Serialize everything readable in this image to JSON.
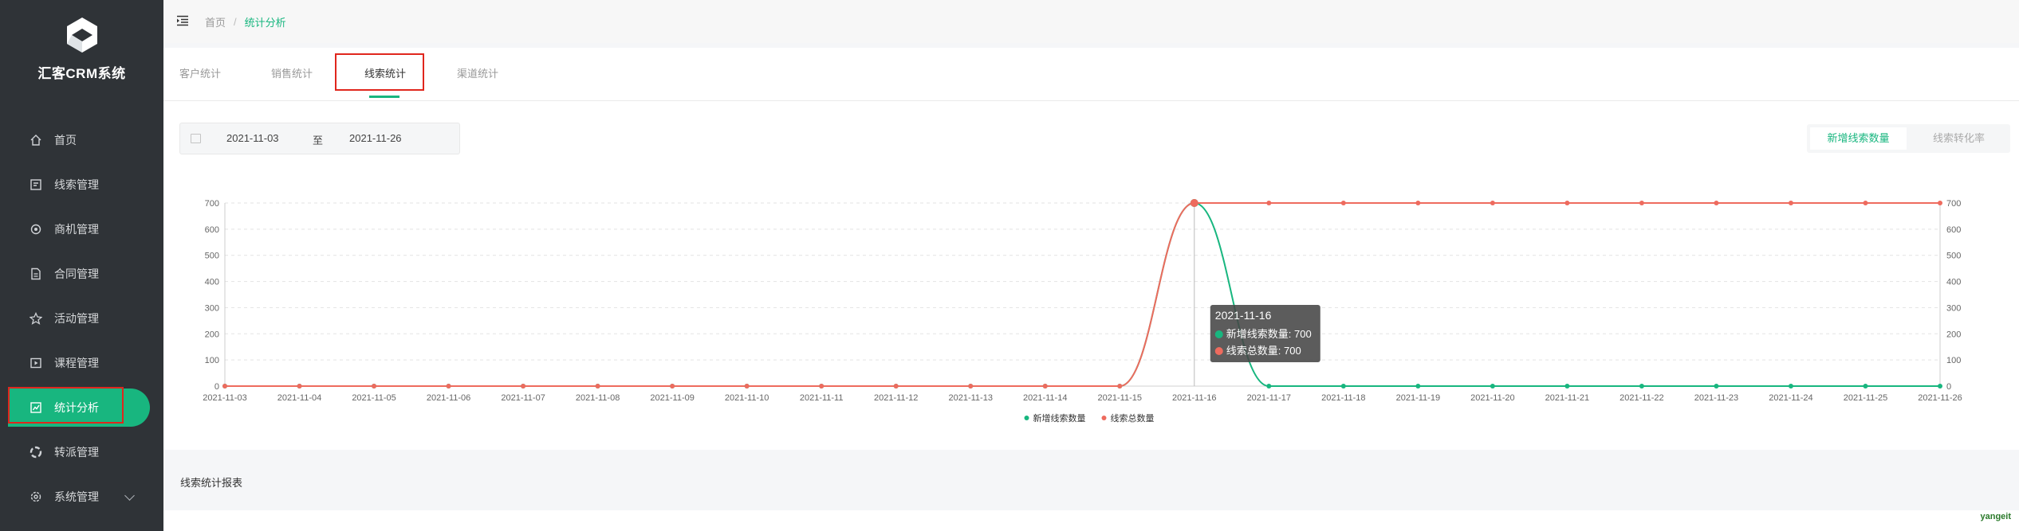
{
  "brand": {
    "name": "汇客CRM系统"
  },
  "sidebar": {
    "items": [
      {
        "label": "首页",
        "icon": "home-icon"
      },
      {
        "label": "线索管理",
        "icon": "clue-icon"
      },
      {
        "label": "商机管理",
        "icon": "opportunity-icon"
      },
      {
        "label": "合同管理",
        "icon": "contract-icon"
      },
      {
        "label": "活动管理",
        "icon": "activity-icon"
      },
      {
        "label": "课程管理",
        "icon": "course-icon"
      },
      {
        "label": "统计分析",
        "icon": "chart-icon",
        "active": true
      },
      {
        "label": "转派管理",
        "icon": "transfer-icon"
      },
      {
        "label": "系统管理",
        "icon": "settings-icon",
        "expandable": true
      }
    ]
  },
  "breadcrumb": {
    "home": "首页",
    "separator": "/",
    "current": "统计分析"
  },
  "tabs": [
    {
      "label": "客户统计"
    },
    {
      "label": "销售统计"
    },
    {
      "label": "线索统计",
      "active": true
    },
    {
      "label": "渠道统计"
    }
  ],
  "date_range": {
    "start": "2021-11-03",
    "separator": "至",
    "end": "2021-11-26"
  },
  "metric_toggle": {
    "selected": "新增线索数量",
    "other": "线索转化率"
  },
  "tooltip": {
    "date": "2021-11-16",
    "line1": "新增线索数量: 700",
    "line2": "线索总数量: 700"
  },
  "report_title": "线索统计报表",
  "watermark": "yangeit",
  "colors": {
    "accent": "#18b67f",
    "series_new": "#18b67f",
    "series_total": "#ee6b5e",
    "sidebar_bg": "#2f3337"
  },
  "chart_data": {
    "type": "line",
    "categories": [
      "2021-11-03",
      "2021-11-04",
      "2021-11-05",
      "2021-11-06",
      "2021-11-07",
      "2021-11-08",
      "2021-11-09",
      "2021-11-10",
      "2021-11-11",
      "2021-11-12",
      "2021-11-13",
      "2021-11-14",
      "2021-11-15",
      "2021-11-16",
      "2021-11-17",
      "2021-11-18",
      "2021-11-19",
      "2021-11-20",
      "2021-11-21",
      "2021-11-22",
      "2021-11-23",
      "2021-11-24",
      "2021-11-25",
      "2021-11-26"
    ],
    "series": [
      {
        "name": "新增线索数量",
        "values": [
          0,
          0,
          0,
          0,
          0,
          0,
          0,
          0,
          0,
          0,
          0,
          0,
          0,
          700,
          0,
          0,
          0,
          0,
          0,
          0,
          0,
          0,
          0,
          0
        ],
        "axis": "left",
        "smooth": true
      },
      {
        "name": "线索总数量",
        "values": [
          0,
          0,
          0,
          0,
          0,
          0,
          0,
          0,
          0,
          0,
          0,
          0,
          0,
          700,
          700,
          700,
          700,
          700,
          700,
          700,
          700,
          700,
          700,
          700
        ],
        "axis": "right",
        "smooth": true
      }
    ],
    "ylim": [
      0,
      700
    ],
    "yticks": [
      0,
      100,
      200,
      300,
      400,
      500,
      600,
      700
    ],
    "grid": true,
    "legend": "bottom-center",
    "highlight_index": 13
  }
}
